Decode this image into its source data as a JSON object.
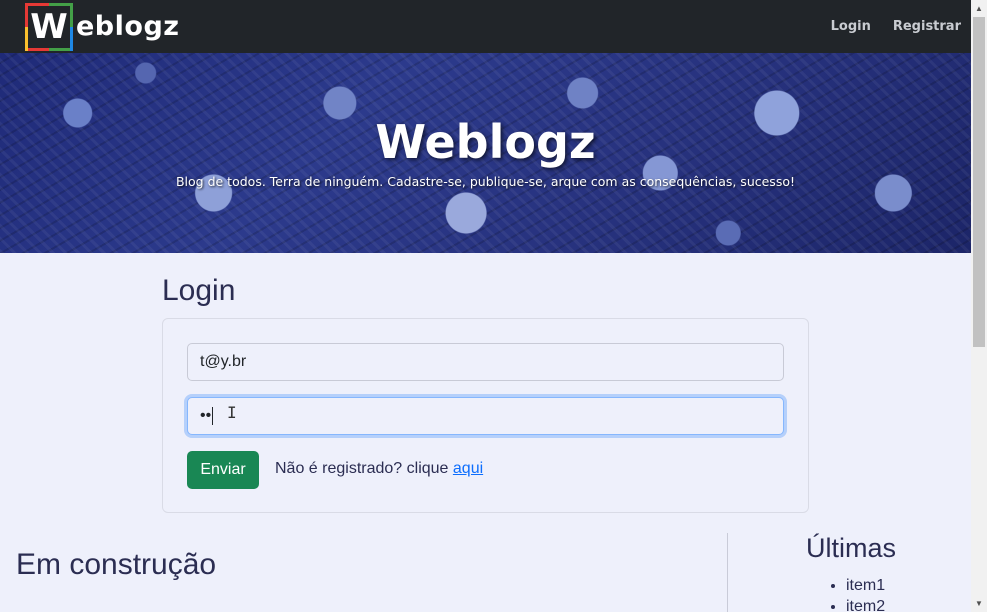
{
  "navbar": {
    "brand_initial": "W",
    "brand_rest": "eblogz",
    "links": [
      "Login",
      "Registrar"
    ]
  },
  "hero": {
    "title": "Weblogz",
    "subtitle": "Blog de todos. Terra de ninguém. Cadastre-se, publique-se, arque com as consequências, sucesso!"
  },
  "login": {
    "heading": "Login",
    "email_value": "t@y.br",
    "password_mask": "••",
    "submit_label": "Enviar",
    "register_prompt": "Não é registrado? clique ",
    "register_link": "aqui"
  },
  "main": {
    "heading": "Em construção"
  },
  "sidebar": {
    "title": "Últimas",
    "items": [
      "item1",
      "item2"
    ]
  },
  "colors": {
    "navbar_bg": "#212529",
    "page_bg": "#eef0fb",
    "button_green": "#198754",
    "link_blue": "#0d6efd"
  }
}
